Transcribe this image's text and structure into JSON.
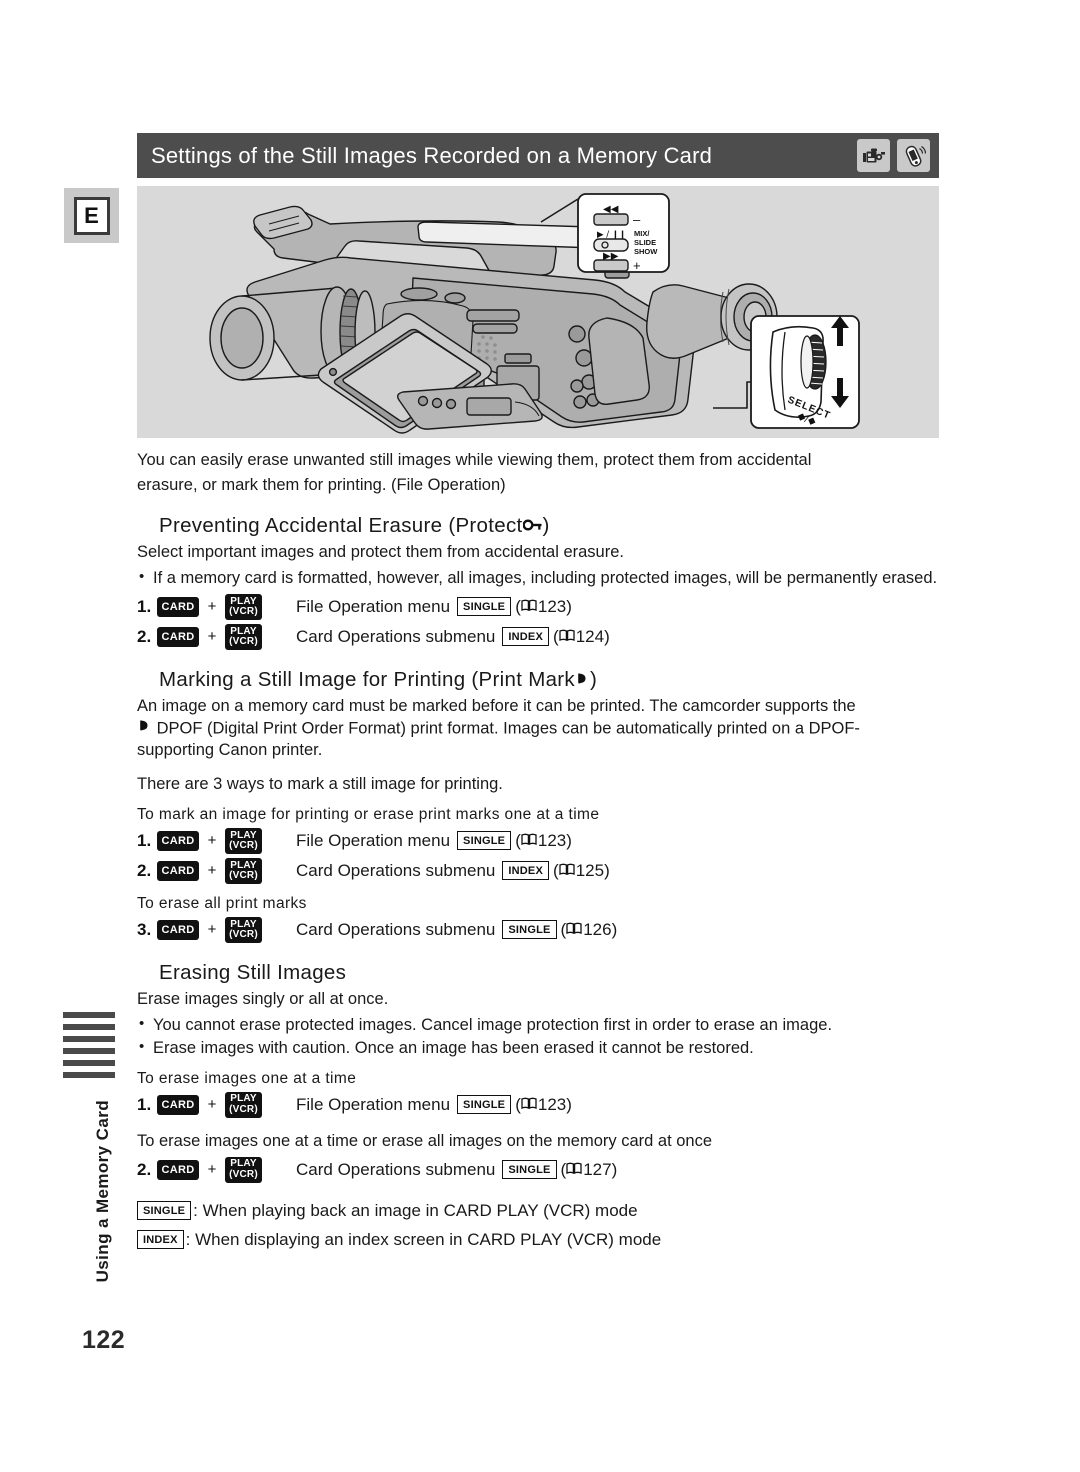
{
  "document": {
    "page_number": "122",
    "language_tab": "E",
    "side_label": "Using a Memory Card"
  },
  "header": {
    "title": "Settings of the Still Images Recorded on a Memory Card",
    "icons": [
      "camcorder-icon",
      "remote-control-icon"
    ]
  },
  "illustration": {
    "callout_buttons": {
      "rewind": "◀◀",
      "minus": "–",
      "play_pause": "▶ / Ⅱ",
      "record_dot": "○",
      "forward": "▶▶",
      "plus": "+",
      "label_line1": "MIX/",
      "label_line2": "SLIDE",
      "label_line3": "SHOW"
    },
    "dial_callout": {
      "label": "SELECT",
      "sub": "♦⁄♦"
    }
  },
  "intro": {
    "line1": "You can easily erase unwanted still images while viewing them, protect them from accidental",
    "line2": "erasure, or mark them for printing. (File Operation)"
  },
  "sections": [
    {
      "id": "protect",
      "heading_main": "Preventing Accidental Erasure (Protect ",
      "heading_tail": ")",
      "heading_icon": "key-icon",
      "intro": "Select important images and protect them from accidental erasure.",
      "bullets": [
        "If a memory card is formatted, however, all images, including protected images, will be permanently erased."
      ],
      "steps": [
        {
          "number": "1.",
          "card": "CARD",
          "plus": "+",
          "play_line1": "PLAY",
          "play_line2": "(VCR)",
          "text": "File Operation menu",
          "mode": "SINGLE",
          "ref_open": "(",
          "page": "123",
          "ref_close": ")"
        },
        {
          "number": "2.",
          "card": "CARD",
          "plus": "+",
          "play_line1": "PLAY",
          "play_line2": "(VCR)",
          "text": "Card Operations submenu",
          "mode": "INDEX",
          "ref_open": "(",
          "page": "124",
          "ref_close": ")"
        }
      ]
    },
    {
      "id": "print-mark",
      "heading_main": "Marking a Still Image for Printing (Print Mark ",
      "heading_tail": ")",
      "heading_icon": "print-mark-icon",
      "para_line1": "An image on a memory card must be marked before it can be printed. The camcorder supports the",
      "para_line2": "DPOF (Digital Print Order Format) print format. Images can be automatically printed on a DPOF-",
      "para_line3": "supporting Canon printer.",
      "para_note": "There are 3 ways to mark a still image for printing.",
      "subhead_1": "To mark an image for printing or erase print marks one at a time",
      "steps_1": [
        {
          "number": "1.",
          "card": "CARD",
          "plus": "+",
          "play_line1": "PLAY",
          "play_line2": "(VCR)",
          "text": "File Operation menu",
          "mode": "SINGLE",
          "ref_open": "(",
          "page": "123",
          "ref_close": ")"
        },
        {
          "number": "2.",
          "card": "CARD",
          "plus": "+",
          "play_line1": "PLAY",
          "play_line2": "(VCR)",
          "text": "Card Operations submenu",
          "mode": "INDEX",
          "ref_open": "(",
          "page": "125",
          "ref_close": ")"
        }
      ],
      "subhead_2": "To erase all print marks",
      "steps_2": [
        {
          "number": "3.",
          "card": "CARD",
          "plus": "+",
          "play_line1": "PLAY",
          "play_line2": "(VCR)",
          "text": "Card Operations submenu",
          "mode": "SINGLE",
          "ref_open": "(",
          "page": "126",
          "ref_close": ")"
        }
      ]
    },
    {
      "id": "erasing",
      "heading_main": "Erasing Still Images",
      "intro": "Erase images singly or all at once.",
      "bullets": [
        "You cannot erase protected images. Cancel image protection first in order to erase an image.",
        "Erase images with caution. Once an image has been erased it cannot be restored."
      ],
      "subhead_1": "To erase images one at a time",
      "steps_1": [
        {
          "number": "1.",
          "card": "CARD",
          "plus": "+",
          "play_line1": "PLAY",
          "play_line2": "(VCR)",
          "text": "File Operation menu",
          "mode": "SINGLE",
          "ref_open": "(",
          "page": "123",
          "ref_close": ")"
        }
      ],
      "subhead_2": "To erase images one at a time or erase all images on the memory card at once",
      "steps_2": [
        {
          "number": "2.",
          "card": "CARD",
          "plus": "+",
          "play_line1": "PLAY",
          "play_line2": "(VCR)",
          "text": "Card Operations submenu",
          "mode": "SINGLE",
          "ref_open": "(",
          "page": "127",
          "ref_close": ")"
        }
      ]
    }
  ],
  "legend": [
    {
      "badge": "SINGLE",
      "text": ": When playing back an image in CARD PLAY (VCR) mode"
    },
    {
      "badge": "INDEX",
      "text": ": When displaying an index screen in CARD PLAY (VCR) mode"
    }
  ],
  "colors": {
    "header_bg": "#4d4d4d",
    "panel_bg": "#d9d9d9",
    "badge_black": "#111111",
    "text": "#1a1a1a"
  }
}
